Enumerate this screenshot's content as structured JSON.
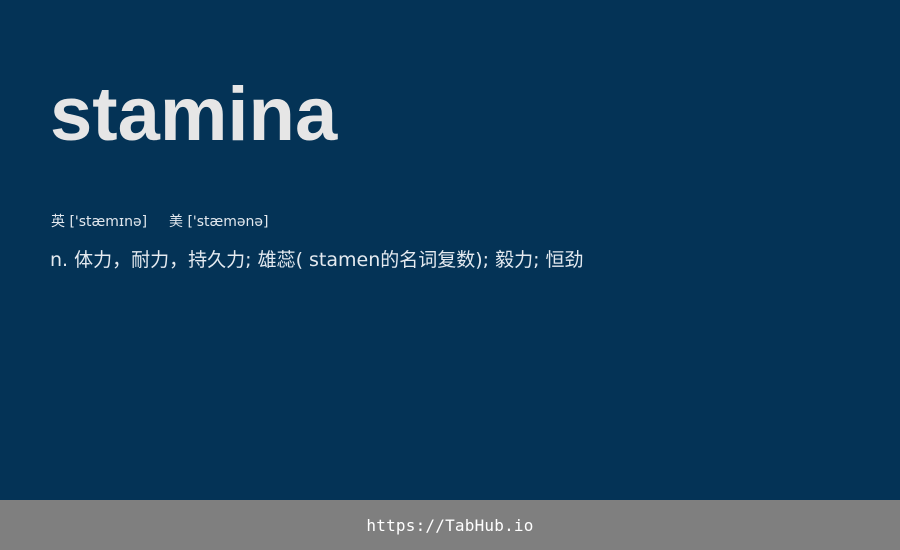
{
  "card": {
    "word": "stamina",
    "phonetic_uk_label": "英",
    "phonetic_uk": "['stæmɪnə]",
    "phonetic_us_label": "美",
    "phonetic_us": "['stæmənə]",
    "definition": "n. 体力，耐力，持久力; 雄蕊( stamen的名词复数); 毅力; 恒劲"
  },
  "footer": {
    "link_text": "https://TabHub.io"
  },
  "colors": {
    "background": "#043356",
    "footer_background": "#7f7f7f",
    "text": "#e6e6e6"
  }
}
